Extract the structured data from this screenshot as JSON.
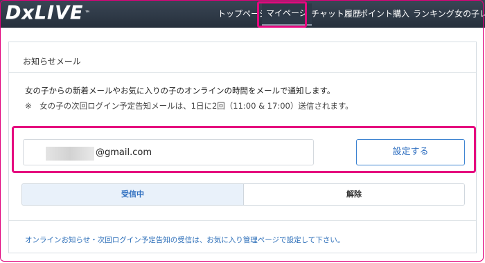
{
  "header": {
    "logo_text": "DxLIVE",
    "logo_tm": "™",
    "nav": [
      {
        "label": "トップページ"
      },
      {
        "label": "マイページ",
        "active": true
      },
      {
        "label": "チャット履歴"
      },
      {
        "label": "ポイント購入"
      },
      {
        "label": "ランキング"
      },
      {
        "label": "女の子レ"
      }
    ]
  },
  "card": {
    "title": "お知らせメール",
    "description": "女の子からの新着メールやお気に入りの子のオンラインの時間をメールで通知します。",
    "notice": "※　女の子の次回ログイン予定告知メールは、1日に2回（11:00 & 17:00）送信されます。",
    "email_domain": "@gmail.com",
    "set_button": "設定する",
    "toggle": {
      "on_label": "受信中",
      "off_label": "解除",
      "selected": "受信中"
    },
    "footer_note": "オンラインお知らせ・次回ログイン予定告知の受信は、お気に入り管理ページで設定して下さい。"
  },
  "colors": {
    "accent_highlight": "#e5087f",
    "link_blue": "#2a6db8",
    "header_bg": "#2e3a48"
  }
}
